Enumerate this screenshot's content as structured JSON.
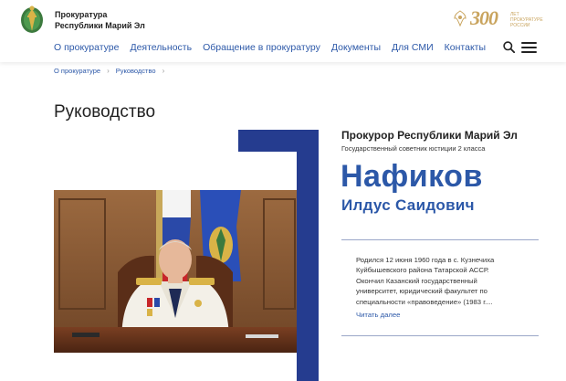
{
  "org": {
    "name_line1": "Прокуратура",
    "name_line2": "Республики Марий Эл"
  },
  "anniversary": {
    "number": "300",
    "label": "лет прокуратуре России"
  },
  "nav": {
    "items": [
      {
        "label": "О прокуратуре"
      },
      {
        "label": "Деятельность"
      },
      {
        "label": "Обращение в прокуратуру"
      },
      {
        "label": "Документы"
      },
      {
        "label": "Для СМИ"
      },
      {
        "label": "Контакты"
      }
    ]
  },
  "breadcrumb": {
    "items": [
      "О прокуратуре",
      "Руководство"
    ],
    "separator": "›"
  },
  "page": {
    "title": "Руководство"
  },
  "profile": {
    "position": "Прокурор Республики Марий Эл",
    "rank": "Государственный советник юстиции 2 класса",
    "surname": "Нафиков",
    "given_names": "Илдус Саидович",
    "bio": "Родился 12 июня 1960 года в с. Кузнечиха Куйбышевского района Татарской АССР. Окончил Казанский государственный университет, юридический факультет по специальности «правоведение» (1983 г....",
    "read_more": "Читать далее"
  },
  "colors": {
    "brand_blue": "#2c58a8",
    "frame_blue": "#253c8f",
    "gold": "#c9a45e"
  }
}
